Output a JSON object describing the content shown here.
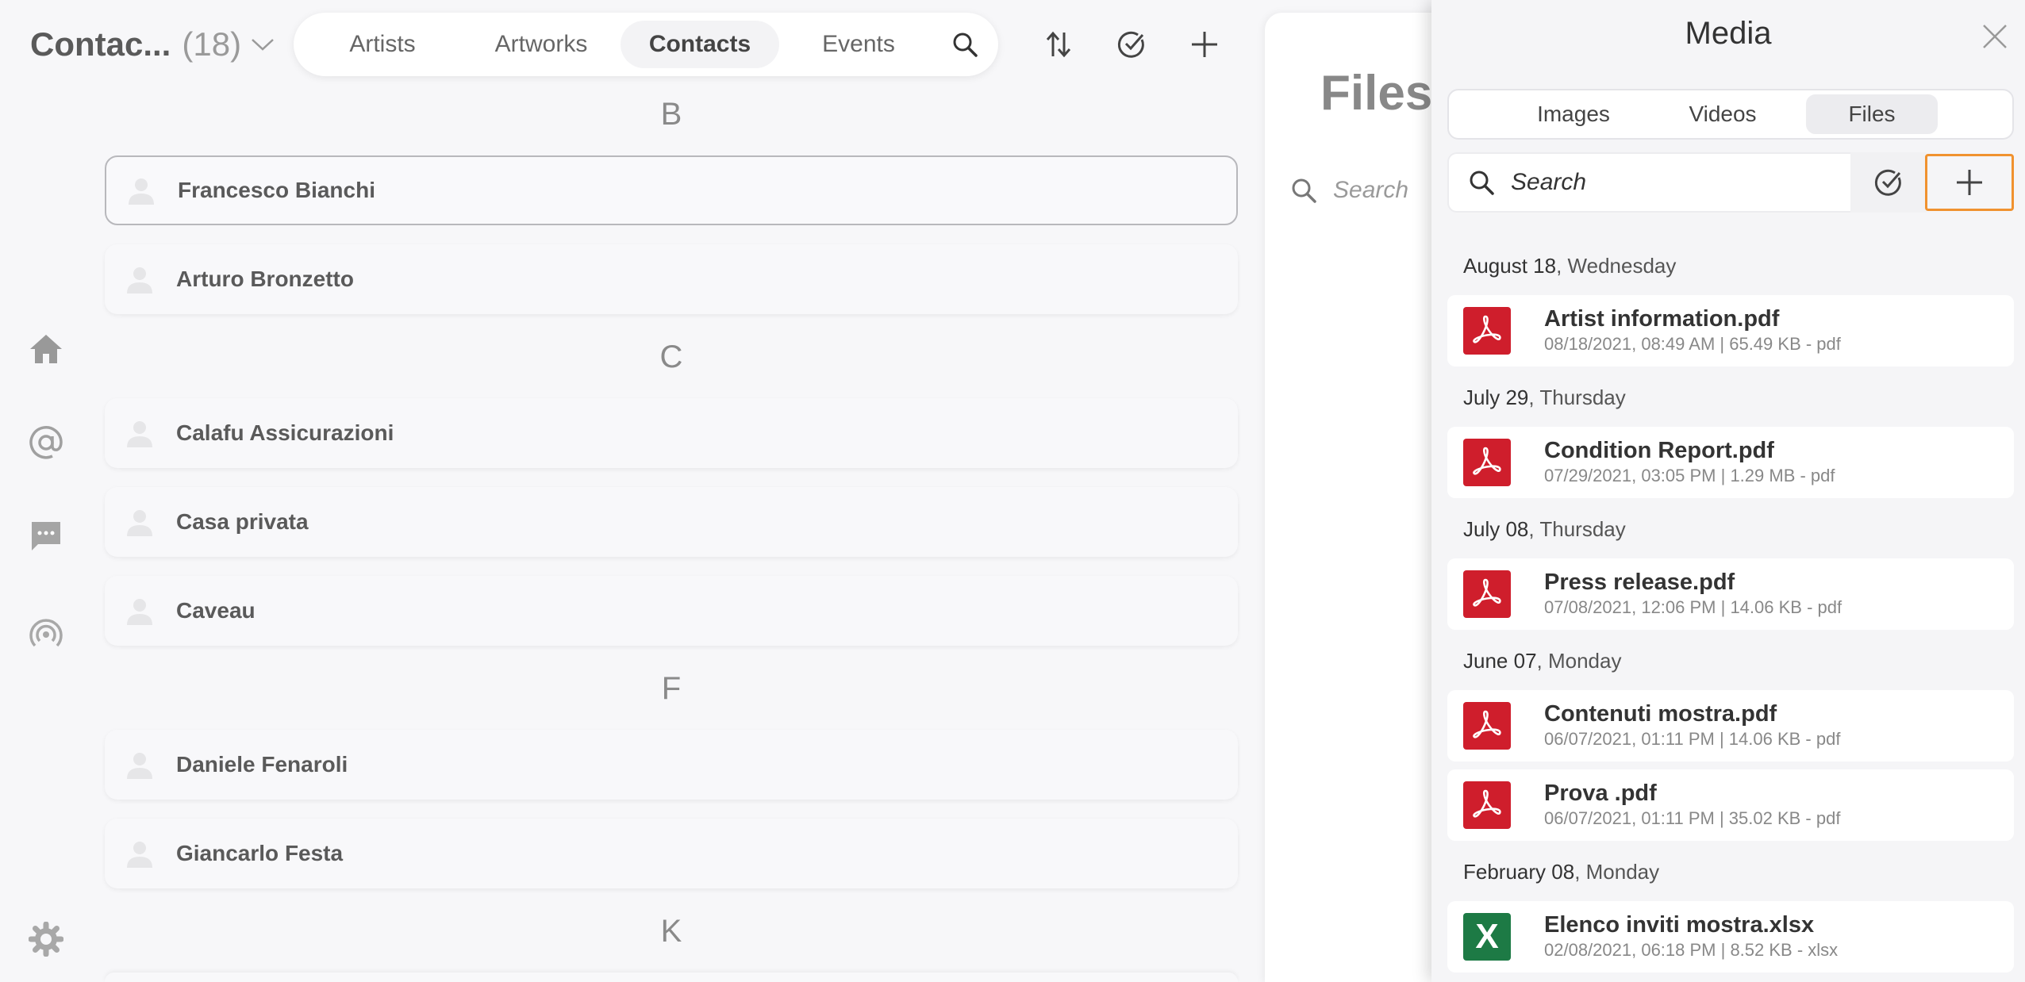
{
  "header": {
    "list_name": "Contac...",
    "list_count": "(18)",
    "tabs": [
      {
        "label": "Artists"
      },
      {
        "label": "Artworks"
      },
      {
        "label": "Contacts"
      },
      {
        "label": "Events"
      }
    ]
  },
  "contacts": {
    "sections": [
      {
        "letter": "B",
        "items": [
          "Francesco Bianchi",
          "Arturo Bronzetto"
        ]
      },
      {
        "letter": "C",
        "items": [
          "Calafu Assicurazioni",
          "Casa privata",
          "Caveau"
        ]
      },
      {
        "letter": "F",
        "items": [
          "Daniele Fenaroli",
          "Giancarlo Festa"
        ]
      },
      {
        "letter": "K",
        "items": []
      }
    ]
  },
  "files_panel": {
    "title": "Files",
    "search_placeholder": "Search"
  },
  "media": {
    "title": "Media",
    "tabs": [
      {
        "label": "Images"
      },
      {
        "label": "Videos"
      },
      {
        "label": "Files"
      }
    ],
    "active_tab": "Files",
    "search_placeholder": "Search",
    "groups": [
      {
        "date": "August 18",
        "weekday": ", Wednesday",
        "files": [
          {
            "name": "Artist information.pdf",
            "meta": "08/18/2021, 08:49 AM | 65.49 KB - pdf",
            "type": "pdf"
          }
        ]
      },
      {
        "date": "July 29",
        "weekday": ", Thursday",
        "files": [
          {
            "name": "Condition Report.pdf",
            "meta": "07/29/2021, 03:05 PM | 1.29 MB - pdf",
            "type": "pdf"
          }
        ]
      },
      {
        "date": "July 08",
        "weekday": ", Thursday",
        "files": [
          {
            "name": "Press release.pdf",
            "meta": "07/08/2021, 12:06 PM | 14.06 KB - pdf",
            "type": "pdf"
          }
        ]
      },
      {
        "date": "June 07",
        "weekday": ", Monday",
        "files": [
          {
            "name": "Contenuti mostra.pdf",
            "meta": "06/07/2021, 01:11 PM | 14.06 KB - pdf",
            "type": "pdf"
          },
          {
            "name": "Prova .pdf",
            "meta": "06/07/2021, 01:11 PM | 35.02 KB - pdf",
            "type": "pdf"
          }
        ]
      },
      {
        "date": "February 08",
        "weekday": ", Monday",
        "files": [
          {
            "name": "Elenco inviti mostra.xlsx",
            "meta": "02/08/2021, 06:18 PM | 8.52 KB - xlsx",
            "type": "xlsx",
            "glyph": "X"
          }
        ]
      }
    ]
  },
  "colors": {
    "accent_outline": "#f0922f",
    "pdf_red": "#cf1e2c",
    "excel_green": "#1d7a45"
  }
}
